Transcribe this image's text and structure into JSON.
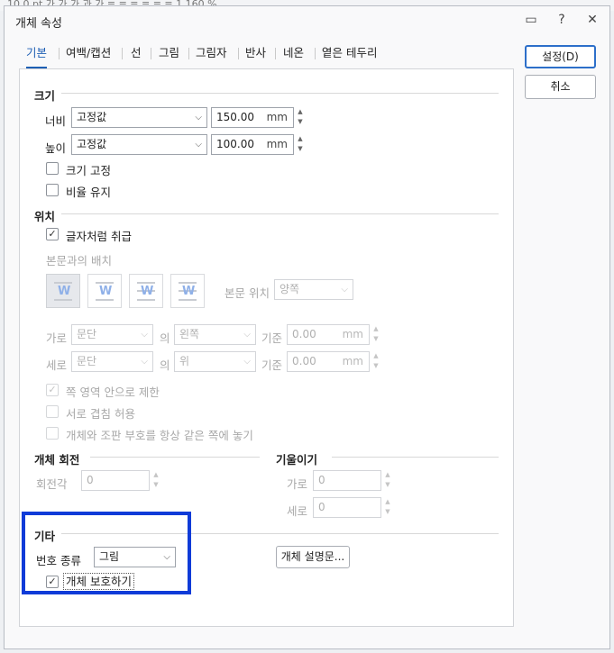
{
  "background": {
    "toolbar_text": "10.0   pt   가  가  가  과  가   ≡  ≡  ≡  ≡  ≡  ≡  1 160  %"
  },
  "title": "개체 속성",
  "window_buttons": {
    "help_icon": "?",
    "close_icon": "✕",
    "caption_icon": "▭"
  },
  "tabs": [
    "기본",
    "여백/캡션",
    "선",
    "그림",
    "그림자",
    "반사",
    "네온",
    "옅은 테두리"
  ],
  "buttons": {
    "ok": "설정(D)",
    "cancel": "취소"
  },
  "size": {
    "header": "크기",
    "width_label": "너비",
    "width_mode": "고정값",
    "width_value": "150.00",
    "height_label": "높이",
    "height_mode": "고정값",
    "height_value": "100.00",
    "unit": "mm",
    "lock_size": "크기 고정",
    "keep_ratio": "비율 유지"
  },
  "position": {
    "header": "위치",
    "treat_as_char": "글자처럼 취급",
    "wrap_label": "본문과의 배치",
    "body_position_label": "본문 위치",
    "body_position_value": "양쪽",
    "horiz_label": "가로",
    "horiz_ref": "문단",
    "of": "의",
    "horiz_align": "왼쪽",
    "basis": "기준",
    "horiz_value": "0.00",
    "vert_label": "세로",
    "vert_ref": "문단",
    "vert_align": "위",
    "vert_value": "0.00",
    "unit": "mm",
    "limit_in_page": "쪽 영역 안으로 제한",
    "allow_overlap": "서로 겹침 허용",
    "same_page": "개체와 조판 부호를 항상 같은 쪽에 놓기"
  },
  "rotation": {
    "header": "개체 회전",
    "angle_label": "회전각",
    "angle_value": "0"
  },
  "skew": {
    "header": "기울이기",
    "horiz_label": "가로",
    "horiz_value": "0",
    "vert_label": "세로",
    "vert_value": "0"
  },
  "misc": {
    "header": "기타",
    "numbering_label": "번호 종류",
    "numbering_value": "그림",
    "protect": "개체 보호하기",
    "description_button": "개체 설명문..."
  },
  "colors": {
    "accent": "#1e5fb4",
    "highlight": "#0f3bd8"
  }
}
